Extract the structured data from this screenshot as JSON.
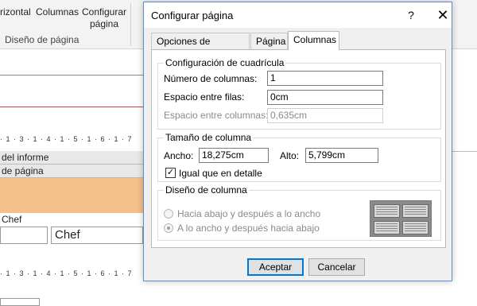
{
  "background": {
    "ribbon": {
      "buttons": [
        {
          "label": "rizontal"
        },
        {
          "label": "Columnas"
        },
        {
          "label_line1": "Configurar",
          "label_line2": "página"
        }
      ],
      "group_label": "Diseño de página"
    },
    "ruler_text": "· 1 · 3 · 1 · 4 · 1 · 5 · 1 · 6 · 1 · 7",
    "ruler_bottom_text": "· 1 · 3 · 1 · 4 · 1 · 5 · 1 · 6 · 1 · 7",
    "sections": [
      {
        "label": "del informe"
      },
      {
        "label": "de página"
      },
      {
        "label": "Chef"
      }
    ],
    "controls": [
      {
        "value": ""
      },
      {
        "value": "Chef"
      }
    ],
    "section_color": "#f3c08c"
  },
  "dialog": {
    "title": "Configurar página",
    "help_label": "?",
    "close_label": "✕",
    "tabs": [
      {
        "label": "Opciones de impresión"
      },
      {
        "label": "Página"
      },
      {
        "label": "Columnas"
      }
    ],
    "active_tab": "Columnas",
    "grid_settings": {
      "legend": "Configuración de cuadrícula",
      "num_columns_label": "Número de columnas:",
      "num_columns_value": "1",
      "row_spacing_label": "Espacio entre filas:",
      "row_spacing_value": "0cm",
      "column_spacing_label": "Espacio entre columnas:",
      "column_spacing_value": "0,635cm"
    },
    "column_size": {
      "legend": "Tamaño de columna",
      "width_label": "Ancho:",
      "width_value": "18,275cm",
      "height_label": "Alto:",
      "height_value": "5,799cm",
      "same_as_detail_label": "Igual que en detalle",
      "same_as_detail_checked": true,
      "check_glyph": "✓"
    },
    "column_layout": {
      "legend": "Diseño de columna",
      "options": [
        {
          "label": "Hacia abajo y después a lo ancho",
          "checked": false
        },
        {
          "label": "A lo ancho y después hacia abajo",
          "checked": true
        }
      ]
    },
    "buttons": {
      "ok_label": "Aceptar",
      "cancel_label": "Cancelar"
    },
    "accent_color": "#0078d7"
  }
}
